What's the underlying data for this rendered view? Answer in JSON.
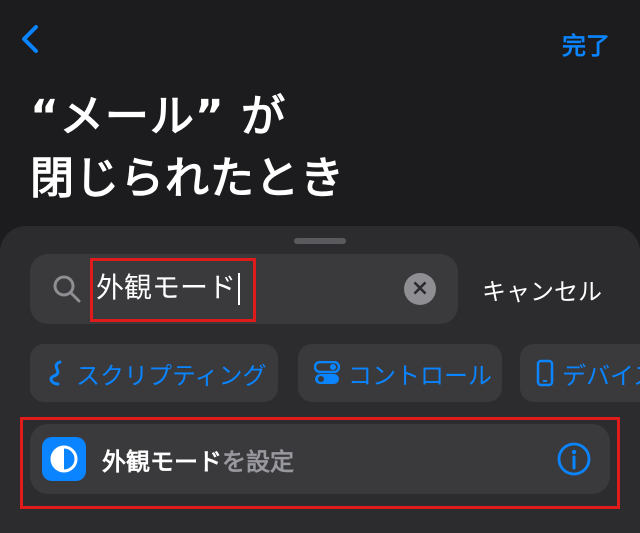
{
  "nav": {
    "done_label": "完了"
  },
  "title": {
    "line1": "“メール” が",
    "line2": "閉じられたとき"
  },
  "search": {
    "value": "外観モード",
    "cancel_label": "キャンセル"
  },
  "chips": [
    {
      "label": "スクリプティング",
      "icon": "scripting-icon"
    },
    {
      "label": "コントロール",
      "icon": "toggle-icon"
    },
    {
      "label": "デバイス",
      "icon": "phone-icon"
    }
  ],
  "result": {
    "label_bold": "外観モード",
    "label_rest": "を設定",
    "icon": "appearance-icon"
  },
  "colors": {
    "accent": "#0a84ff",
    "background": "#1c1c1e",
    "sheet": "#2c2c2e",
    "highlight": "#e01b1b"
  }
}
